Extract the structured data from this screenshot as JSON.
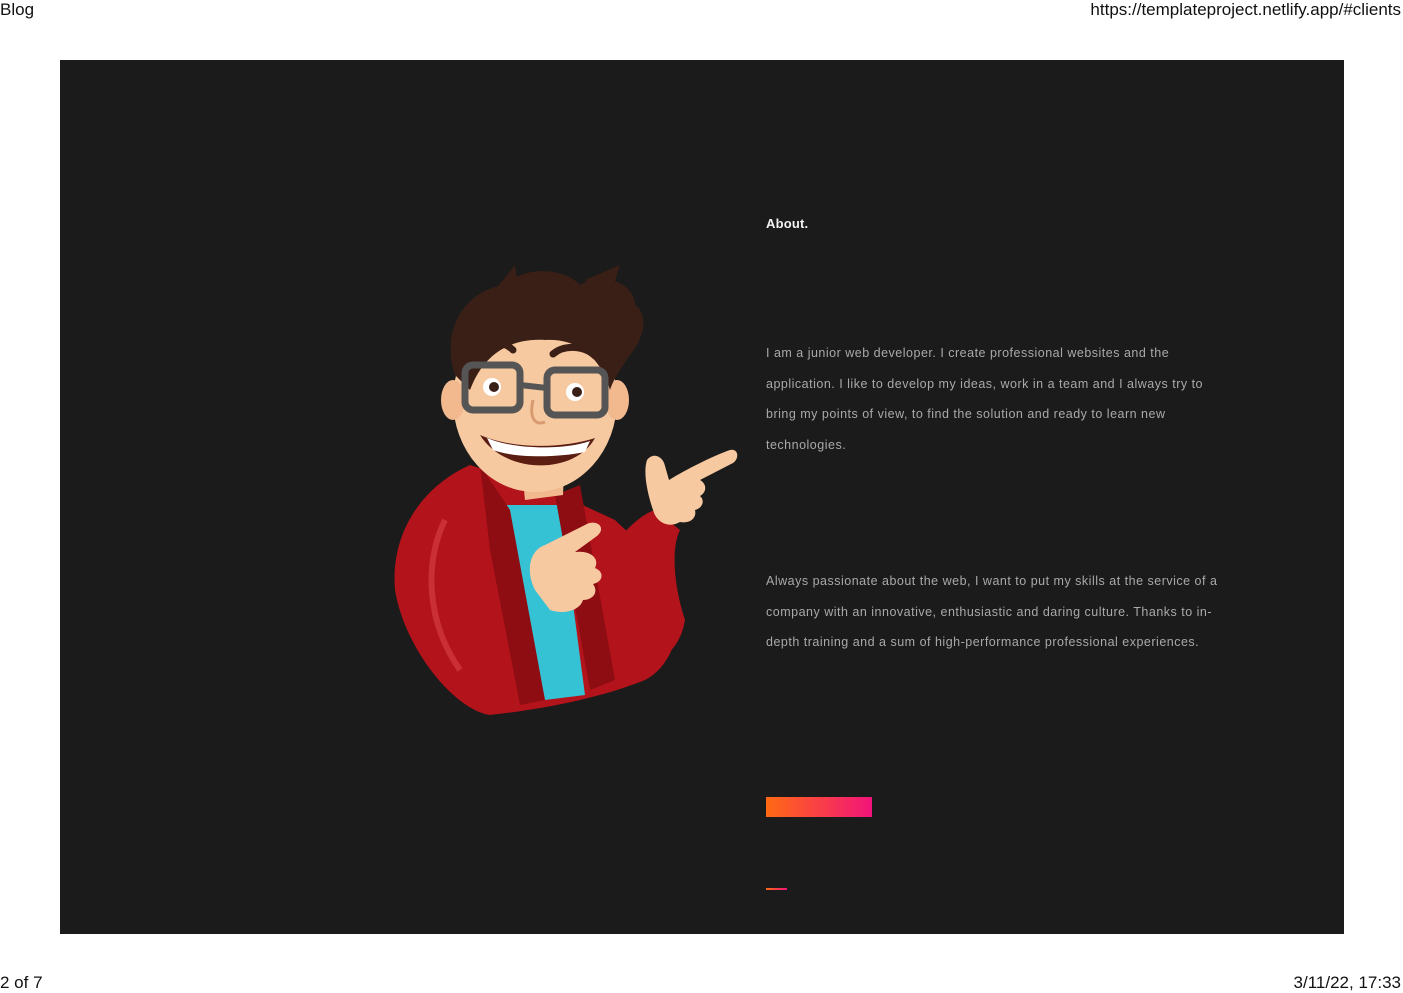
{
  "print_header": {
    "title": "Blog",
    "url": "https://templateproject.netlify.app/#clients"
  },
  "print_footer": {
    "page_indicator": "2 of 7",
    "datetime": "3/11/22, 17:33"
  },
  "about": {
    "title": "About.",
    "paragraph_1": "I am a junior web developer. I create professional websites and the application. I like to develop my ideas, work in a team and I always try to bring my points of view, to find the solution and ready to learn new technologies.",
    "paragraph_2": "Always passionate about the web, I want to put my skills at the service of a company with an innovative, enthusiastic and daring culture. Thanks to in-depth training and a sum of high-performance professional experiences."
  },
  "colors": {
    "page_bg": "#1b1b1b",
    "accent_start": "#ff6a13",
    "accent_end": "#f2147a",
    "text_primary": "#f2f2f2",
    "text_muted": "#a9a9a9"
  },
  "icons": {
    "avatar": "cartoon-developer-avatar"
  }
}
